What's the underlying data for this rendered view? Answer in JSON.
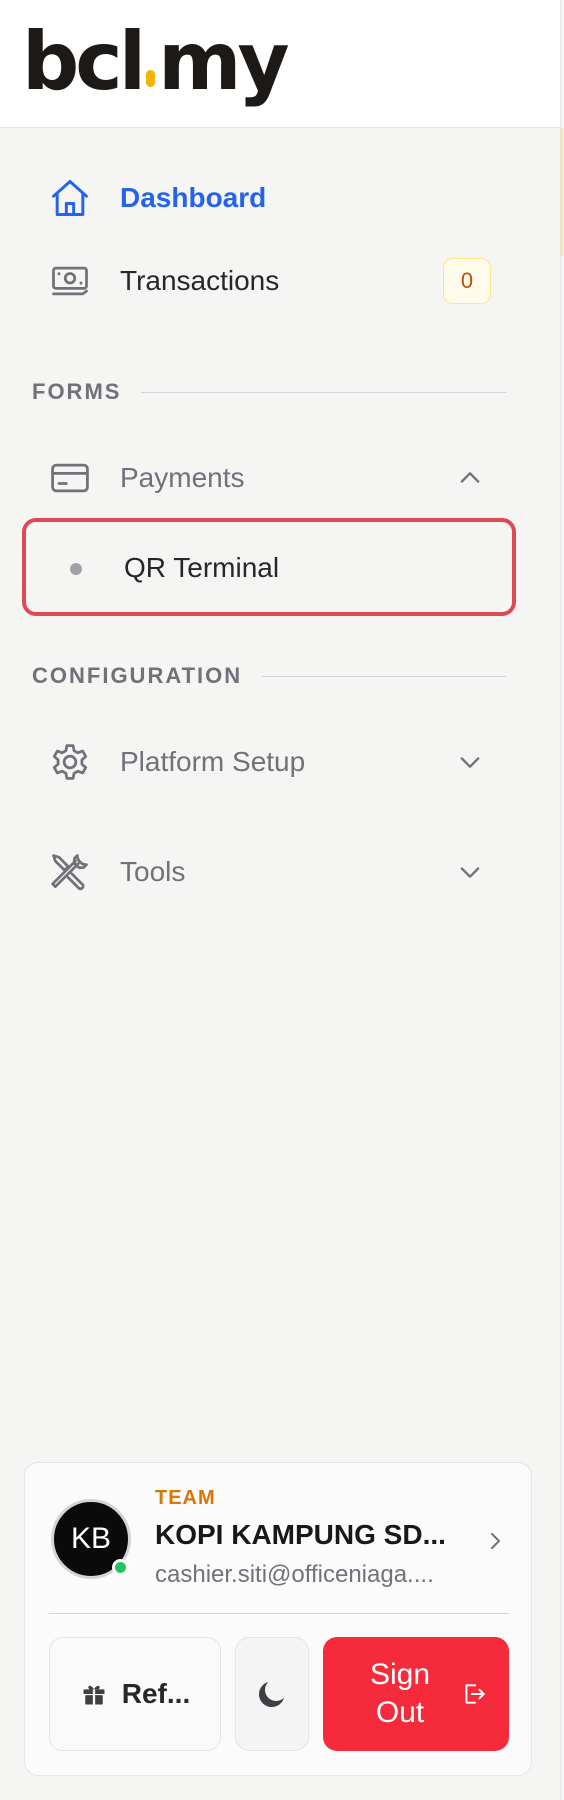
{
  "brand": {
    "logo_left": "bcl",
    "logo_right": "my",
    "accent_color": "#f5b301"
  },
  "nav": {
    "dashboard": {
      "label": "Dashboard",
      "icon": "home-icon",
      "active": true
    },
    "transactions": {
      "label": "Transactions",
      "icon": "banknote-icon",
      "badge": "0"
    }
  },
  "sections": {
    "forms": "FORMS",
    "configuration": "CONFIGURATION"
  },
  "forms": {
    "payments": {
      "label": "Payments",
      "icon": "credit-card-icon",
      "expanded": true
    },
    "qr_terminal": {
      "label": "QR Terminal"
    }
  },
  "configuration": {
    "platform_setup": {
      "label": "Platform Setup",
      "icon": "gear-icon",
      "expanded": false
    },
    "tools": {
      "label": "Tools",
      "icon": "wrench-screwdriver-icon",
      "expanded": false
    }
  },
  "account": {
    "avatar_initials": "KB",
    "status": "online",
    "team_label": "TEAM",
    "team_name": "KOPI KAMPUNG SD...",
    "email": "cashier.siti@officeniaga...."
  },
  "actions": {
    "referral_label": "Ref...",
    "theme_icon": "moon-icon",
    "signout_label": "Sign Out"
  },
  "colors": {
    "active_nav": "#2563eb",
    "signout_bg": "#f52b3b",
    "highlight_border": "#dc4a56",
    "team_label": "#d97706",
    "badge": "#b45309"
  }
}
